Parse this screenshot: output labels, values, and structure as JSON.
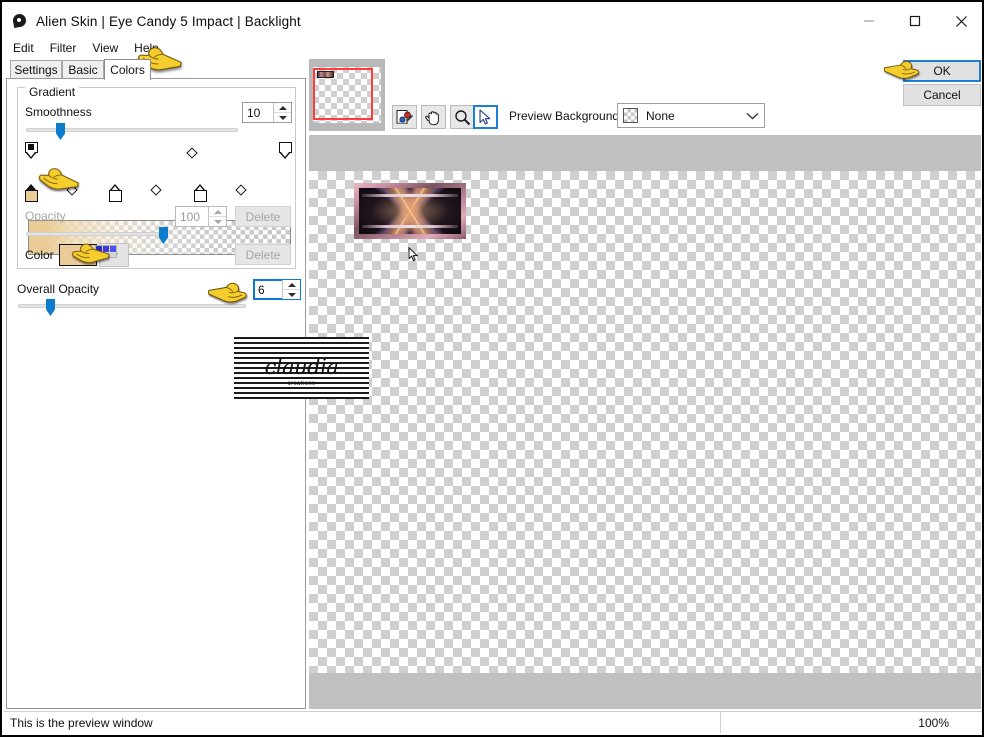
{
  "window": {
    "title": "Alien Skin | Eye Candy 5 Impact | Backlight",
    "icon": "app-drop-icon",
    "minimize_label": "Minimize",
    "maximize_label": "Maximize",
    "close_label": "Close"
  },
  "menu": {
    "items": [
      {
        "label": "Edit"
      },
      {
        "label": "Filter"
      },
      {
        "label": "View"
      },
      {
        "label": "Help"
      }
    ]
  },
  "tabs": {
    "items": [
      {
        "label": "Settings",
        "active": false
      },
      {
        "label": "Basic",
        "active": false
      },
      {
        "label": "Colors",
        "active": true
      }
    ]
  },
  "gradient_group": {
    "title": "Gradient",
    "smoothness": {
      "label": "Smoothness",
      "value": "10",
      "slider_percent": 12
    },
    "opacity": {
      "label": "Opacity",
      "value": "100",
      "slider_percent": 62,
      "disabled": true,
      "delete_label": "Delete"
    },
    "color": {
      "label": "Color",
      "swatch_hex": "#EBCB96",
      "delete_label": "Delete",
      "dropdown_icon": "chevron-down-icon"
    },
    "strip": {
      "start_hex": "#EBCB96",
      "end_hex": "#FFFFFF",
      "end_alpha": 0
    },
    "opacity_stops": [
      {
        "position_percent": 0,
        "filled": true
      },
      {
        "position_percent": 100,
        "filled": false
      }
    ],
    "opacity_midpoints": [
      {
        "position_percent": 56
      }
    ],
    "color_stops": [
      {
        "position_percent": 0,
        "filled": true,
        "hex": "#EBCB96"
      },
      {
        "position_percent": 32,
        "filled": false,
        "hex": "#FFFFFF"
      },
      {
        "position_percent": 64,
        "filled": false,
        "hex": "#FFFFFF"
      }
    ],
    "color_midpoints": [
      {
        "position_percent": 17
      },
      {
        "position_percent": 48
      },
      {
        "position_percent": 79
      }
    ]
  },
  "overall_opacity": {
    "label": "Overall Opacity",
    "value": "6",
    "slider_percent": 12
  },
  "preview_toolbar": {
    "tools": [
      {
        "name": "color-picker-tool",
        "active": false
      },
      {
        "name": "hand-tool",
        "active": false
      },
      {
        "name": "zoom-tool",
        "active": false
      },
      {
        "name": "arrow-tool",
        "active": true
      }
    ],
    "background_label": "Preview Background:",
    "background_value": "None",
    "background_chevron": "chevron-down-icon"
  },
  "dialog_buttons": {
    "ok_label": "OK",
    "cancel_label": "Cancel"
  },
  "statusbar": {
    "message": "This is the preview window",
    "zoom": "100%"
  },
  "watermark": {
    "name": "claudia",
    "subtitle": "creations"
  },
  "annotations": {
    "pointer_icon": "pointing-hand-cursor",
    "count": 5
  },
  "colors": {
    "accent_blue": "#0C7CCF",
    "focus_blue": "#1F7FD4",
    "viewport_red": "#FF3B3B",
    "gradient_tan": "#EBCB96",
    "canvas_gray": "#C0C0C0",
    "button_gray": "#E1E1E1"
  }
}
